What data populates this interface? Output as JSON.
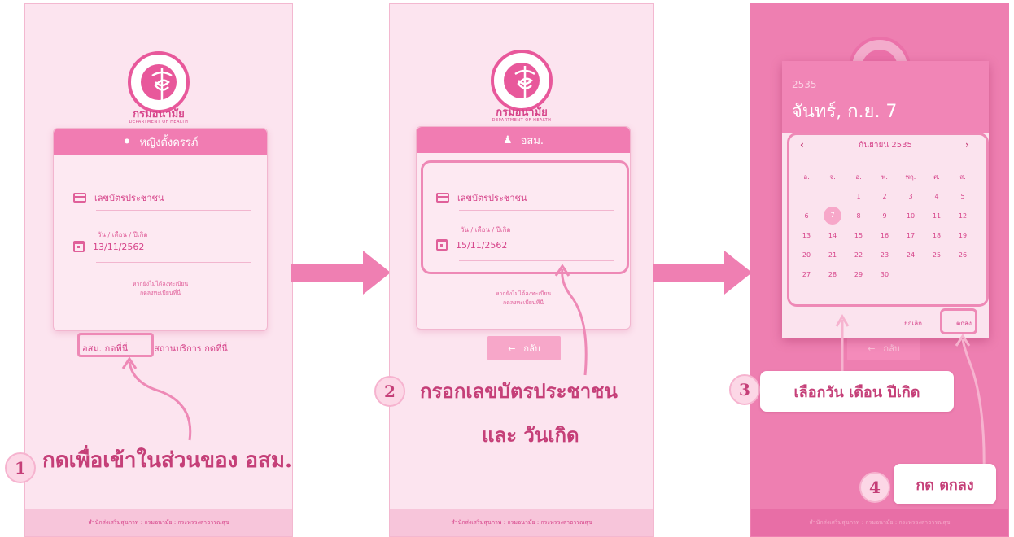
{
  "panel1": {
    "dept_name": "กรมอนามัย",
    "dept_sub": "DEPARTMENT OF HEALTH",
    "card_title": "หญิงตั้งครรภ์",
    "id_label": "เลขบัตรประชาชน",
    "dob_label": "วัน / เดือน / ปีเกิด",
    "dob_value": "13/11/2562",
    "hint_line1": "หากยังไม่ได้ลงทะเบียน",
    "hint_line2": "กดลงทะเบียนที่นี่",
    "link_osm": "อสม. กดที่นี่",
    "link_service": "สถานบริการ กดที่นี่",
    "footer": "สำนักส่งเสริมสุขภาพ : กรมอนามัย : กระทรวงสาธารณสุข"
  },
  "panel2": {
    "dept_name": "กรมอนามัย",
    "dept_sub": "DEPARTMENT OF HEALTH",
    "card_title": "อสม.",
    "id_label": "เลขบัตรประชาชน",
    "dob_label": "วัน / เดือน / ปีเกิด",
    "dob_value": "15/11/2562",
    "hint_line1": "หากยังไม่ได้ลงทะเบียน",
    "hint_line2": "กดลงทะเบียนที่นี่",
    "back_label": "กลับ",
    "footer": "สำนักส่งเสริมสุขภาพ : กรมอนามัย : กระทรวงสาธารณสุข"
  },
  "panel3": {
    "year": "2535",
    "selected_date": "จันทร์, ก.ย. 7",
    "month_label": "กันยายน 2535",
    "weekdays": [
      "อ.",
      "จ.",
      "อ.",
      "พ.",
      "พฤ.",
      "ศ.",
      "ส."
    ],
    "weeks": [
      [
        "",
        "",
        "1",
        "2",
        "3",
        "4",
        "5"
      ],
      [
        "6",
        "7",
        "8",
        "9",
        "10",
        "11",
        "12"
      ],
      [
        "13",
        "14",
        "15",
        "16",
        "17",
        "18",
        "19"
      ],
      [
        "20",
        "21",
        "22",
        "23",
        "24",
        "25",
        "26"
      ],
      [
        "27",
        "28",
        "29",
        "30",
        "",
        "",
        ""
      ]
    ],
    "selected_day": "7",
    "cancel_label": "ยกเลิก",
    "ok_label": "ตกลง",
    "back_label": "กลับ",
    "footer": "สำนักส่งเสริมสุขภาพ : กรมอนามัย : กระทรวงสาธารณสุข"
  },
  "steps": {
    "s1_num": "1",
    "s1_text": "กดเพื่อเข้าในส่วนของ อสม.",
    "s2_num": "2",
    "s2_line1": "กรอกเลขบัตรประชาชน",
    "s2_line2": "และ วันเกิด",
    "s3_num": "3",
    "s3_text": "เลือกวัน เดือน ปีเกิด",
    "s4_num": "4",
    "s4_text": "กด ตกลง"
  },
  "colors": {
    "accent": "#f17cb2",
    "annotation": "#c53f78",
    "panel_bg": "#fce4ef",
    "dim_bg": "#ee7fb1"
  }
}
